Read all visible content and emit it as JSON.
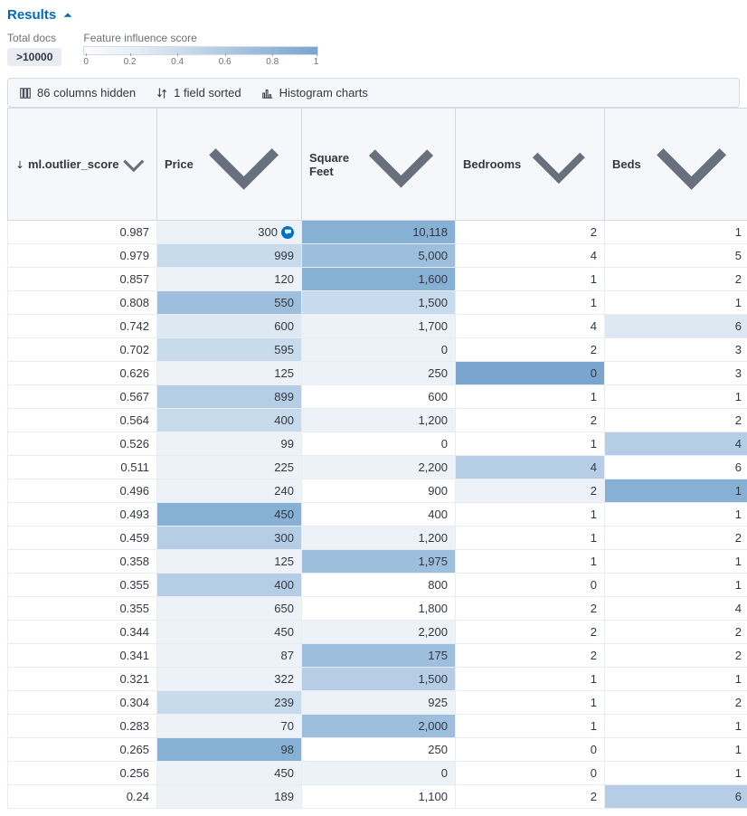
{
  "header": {
    "title": "Results"
  },
  "summary": {
    "total_docs_label": "Total docs",
    "total_docs_value": ">10000",
    "legend_label": "Feature influence score",
    "legend_ticks": [
      "0",
      "0.2",
      "0.4",
      "0.6",
      "0.8",
      "1"
    ]
  },
  "toolbar": {
    "columns_hidden": "86 columns hidden",
    "fields_sorted": "1 field sorted",
    "histogram": "Histogram charts"
  },
  "columns": [
    {
      "key": "outlier",
      "label": "ml.outlier_score",
      "sorted": "desc"
    },
    {
      "key": "price",
      "label": "Price"
    },
    {
      "key": "sqft",
      "label": "Square Feet"
    },
    {
      "key": "bedrooms",
      "label": "Bedrooms"
    },
    {
      "key": "beds",
      "label": "Beds"
    }
  ],
  "heat_colors": {
    "0": "transparent",
    "1": "#edf2f8",
    "2": "#dde8f2",
    "3": "#c8dbec",
    "4": "#b5cee5",
    "5": "#9dbfdd",
    "6": "#86b1d5",
    "7": "#79a5cf"
  },
  "rows": [
    {
      "outlier": "0.987",
      "price": "300",
      "price_heat": 1,
      "price_popover": true,
      "sqft": "10,118",
      "sqft_heat": 6,
      "bedrooms": "2",
      "bedrooms_heat": 0,
      "beds": "1",
      "beds_heat": 0
    },
    {
      "outlier": "0.979",
      "price": "999",
      "price_heat": 3,
      "sqft": "5,000",
      "sqft_heat": 5,
      "bedrooms": "4",
      "bedrooms_heat": 0,
      "beds": "5",
      "beds_heat": 0
    },
    {
      "outlier": "0.857",
      "price": "120",
      "price_heat": 1,
      "sqft": "1,600",
      "sqft_heat": 6,
      "bedrooms": "1",
      "bedrooms_heat": 0,
      "beds": "2",
      "beds_heat": 0
    },
    {
      "outlier": "0.808",
      "price": "550",
      "price_heat": 5,
      "sqft": "1,500",
      "sqft_heat": 3,
      "bedrooms": "1",
      "bedrooms_heat": 0,
      "beds": "1",
      "beds_heat": 0
    },
    {
      "outlier": "0.742",
      "price": "600",
      "price_heat": 2,
      "sqft": "1,700",
      "sqft_heat": 1,
      "bedrooms": "4",
      "bedrooms_heat": 0,
      "beds": "6",
      "beds_heat": 2
    },
    {
      "outlier": "0.702",
      "price": "595",
      "price_heat": 3,
      "sqft": "0",
      "sqft_heat": 1,
      "bedrooms": "2",
      "bedrooms_heat": 0,
      "beds": "3",
      "beds_heat": 0
    },
    {
      "outlier": "0.626",
      "price": "125",
      "price_heat": 1,
      "sqft": "250",
      "sqft_heat": 1,
      "bedrooms": "0",
      "bedrooms_heat": 7,
      "beds": "3",
      "beds_heat": 0
    },
    {
      "outlier": "0.567",
      "price": "899",
      "price_heat": 4,
      "sqft": "600",
      "sqft_heat": 0,
      "bedrooms": "1",
      "bedrooms_heat": 0,
      "beds": "1",
      "beds_heat": 0
    },
    {
      "outlier": "0.564",
      "price": "400",
      "price_heat": 3,
      "sqft": "1,200",
      "sqft_heat": 1,
      "bedrooms": "2",
      "bedrooms_heat": 0,
      "beds": "2",
      "beds_heat": 0
    },
    {
      "outlier": "0.526",
      "price": "99",
      "price_heat": 1,
      "sqft": "0",
      "sqft_heat": 0,
      "bedrooms": "1",
      "bedrooms_heat": 0,
      "beds": "4",
      "beds_heat": 4
    },
    {
      "outlier": "0.511",
      "price": "225",
      "price_heat": 1,
      "sqft": "2,200",
      "sqft_heat": 1,
      "bedrooms": "4",
      "bedrooms_heat": 4,
      "beds": "6",
      "beds_heat": 0
    },
    {
      "outlier": "0.496",
      "price": "240",
      "price_heat": 1,
      "sqft": "900",
      "sqft_heat": 0,
      "bedrooms": "2",
      "bedrooms_heat": 1,
      "beds": "1",
      "beds_heat": 6
    },
    {
      "outlier": "0.493",
      "price": "450",
      "price_heat": 6,
      "sqft": "400",
      "sqft_heat": 0,
      "bedrooms": "1",
      "bedrooms_heat": 0,
      "beds": "1",
      "beds_heat": 0
    },
    {
      "outlier": "0.459",
      "price": "300",
      "price_heat": 4,
      "sqft": "1,200",
      "sqft_heat": 1,
      "bedrooms": "1",
      "bedrooms_heat": 0,
      "beds": "2",
      "beds_heat": 0
    },
    {
      "outlier": "0.358",
      "price": "125",
      "price_heat": 1,
      "sqft": "1,975",
      "sqft_heat": 5,
      "bedrooms": "1",
      "bedrooms_heat": 0,
      "beds": "1",
      "beds_heat": 0
    },
    {
      "outlier": "0.355",
      "price": "400",
      "price_heat": 4,
      "sqft": "800",
      "sqft_heat": 0,
      "bedrooms": "0",
      "bedrooms_heat": 0,
      "beds": "1",
      "beds_heat": 0
    },
    {
      "outlier": "0.355",
      "price": "650",
      "price_heat": 1,
      "sqft": "1,800",
      "sqft_heat": 0,
      "bedrooms": "2",
      "bedrooms_heat": 0,
      "beds": "4",
      "beds_heat": 0
    },
    {
      "outlier": "0.344",
      "price": "450",
      "price_heat": 1,
      "sqft": "2,200",
      "sqft_heat": 1,
      "bedrooms": "2",
      "bedrooms_heat": 0,
      "beds": "2",
      "beds_heat": 0
    },
    {
      "outlier": "0.341",
      "price": "87",
      "price_heat": 1,
      "sqft": "175",
      "sqft_heat": 5,
      "bedrooms": "2",
      "bedrooms_heat": 0,
      "beds": "2",
      "beds_heat": 0
    },
    {
      "outlier": "0.321",
      "price": "322",
      "price_heat": 1,
      "sqft": "1,500",
      "sqft_heat": 4,
      "bedrooms": "1",
      "bedrooms_heat": 0,
      "beds": "1",
      "beds_heat": 0
    },
    {
      "outlier": "0.304",
      "price": "239",
      "price_heat": 3,
      "sqft": "925",
      "sqft_heat": 1,
      "bedrooms": "1",
      "bedrooms_heat": 0,
      "beds": "2",
      "beds_heat": 0
    },
    {
      "outlier": "0.283",
      "price": "70",
      "price_heat": 1,
      "sqft": "2,000",
      "sqft_heat": 5,
      "bedrooms": "1",
      "bedrooms_heat": 0,
      "beds": "1",
      "beds_heat": 0
    },
    {
      "outlier": "0.265",
      "price": "98",
      "price_heat": 6,
      "sqft": "250",
      "sqft_heat": 0,
      "bedrooms": "0",
      "bedrooms_heat": 0,
      "beds": "1",
      "beds_heat": 0
    },
    {
      "outlier": "0.256",
      "price": "450",
      "price_heat": 1,
      "sqft": "0",
      "sqft_heat": 1,
      "bedrooms": "0",
      "bedrooms_heat": 0,
      "beds": "1",
      "beds_heat": 0
    },
    {
      "outlier": "0.24",
      "price": "189",
      "price_heat": 1,
      "sqft": "1,100",
      "sqft_heat": 0,
      "bedrooms": "2",
      "bedrooms_heat": 0,
      "beds": "6",
      "beds_heat": 4
    }
  ]
}
